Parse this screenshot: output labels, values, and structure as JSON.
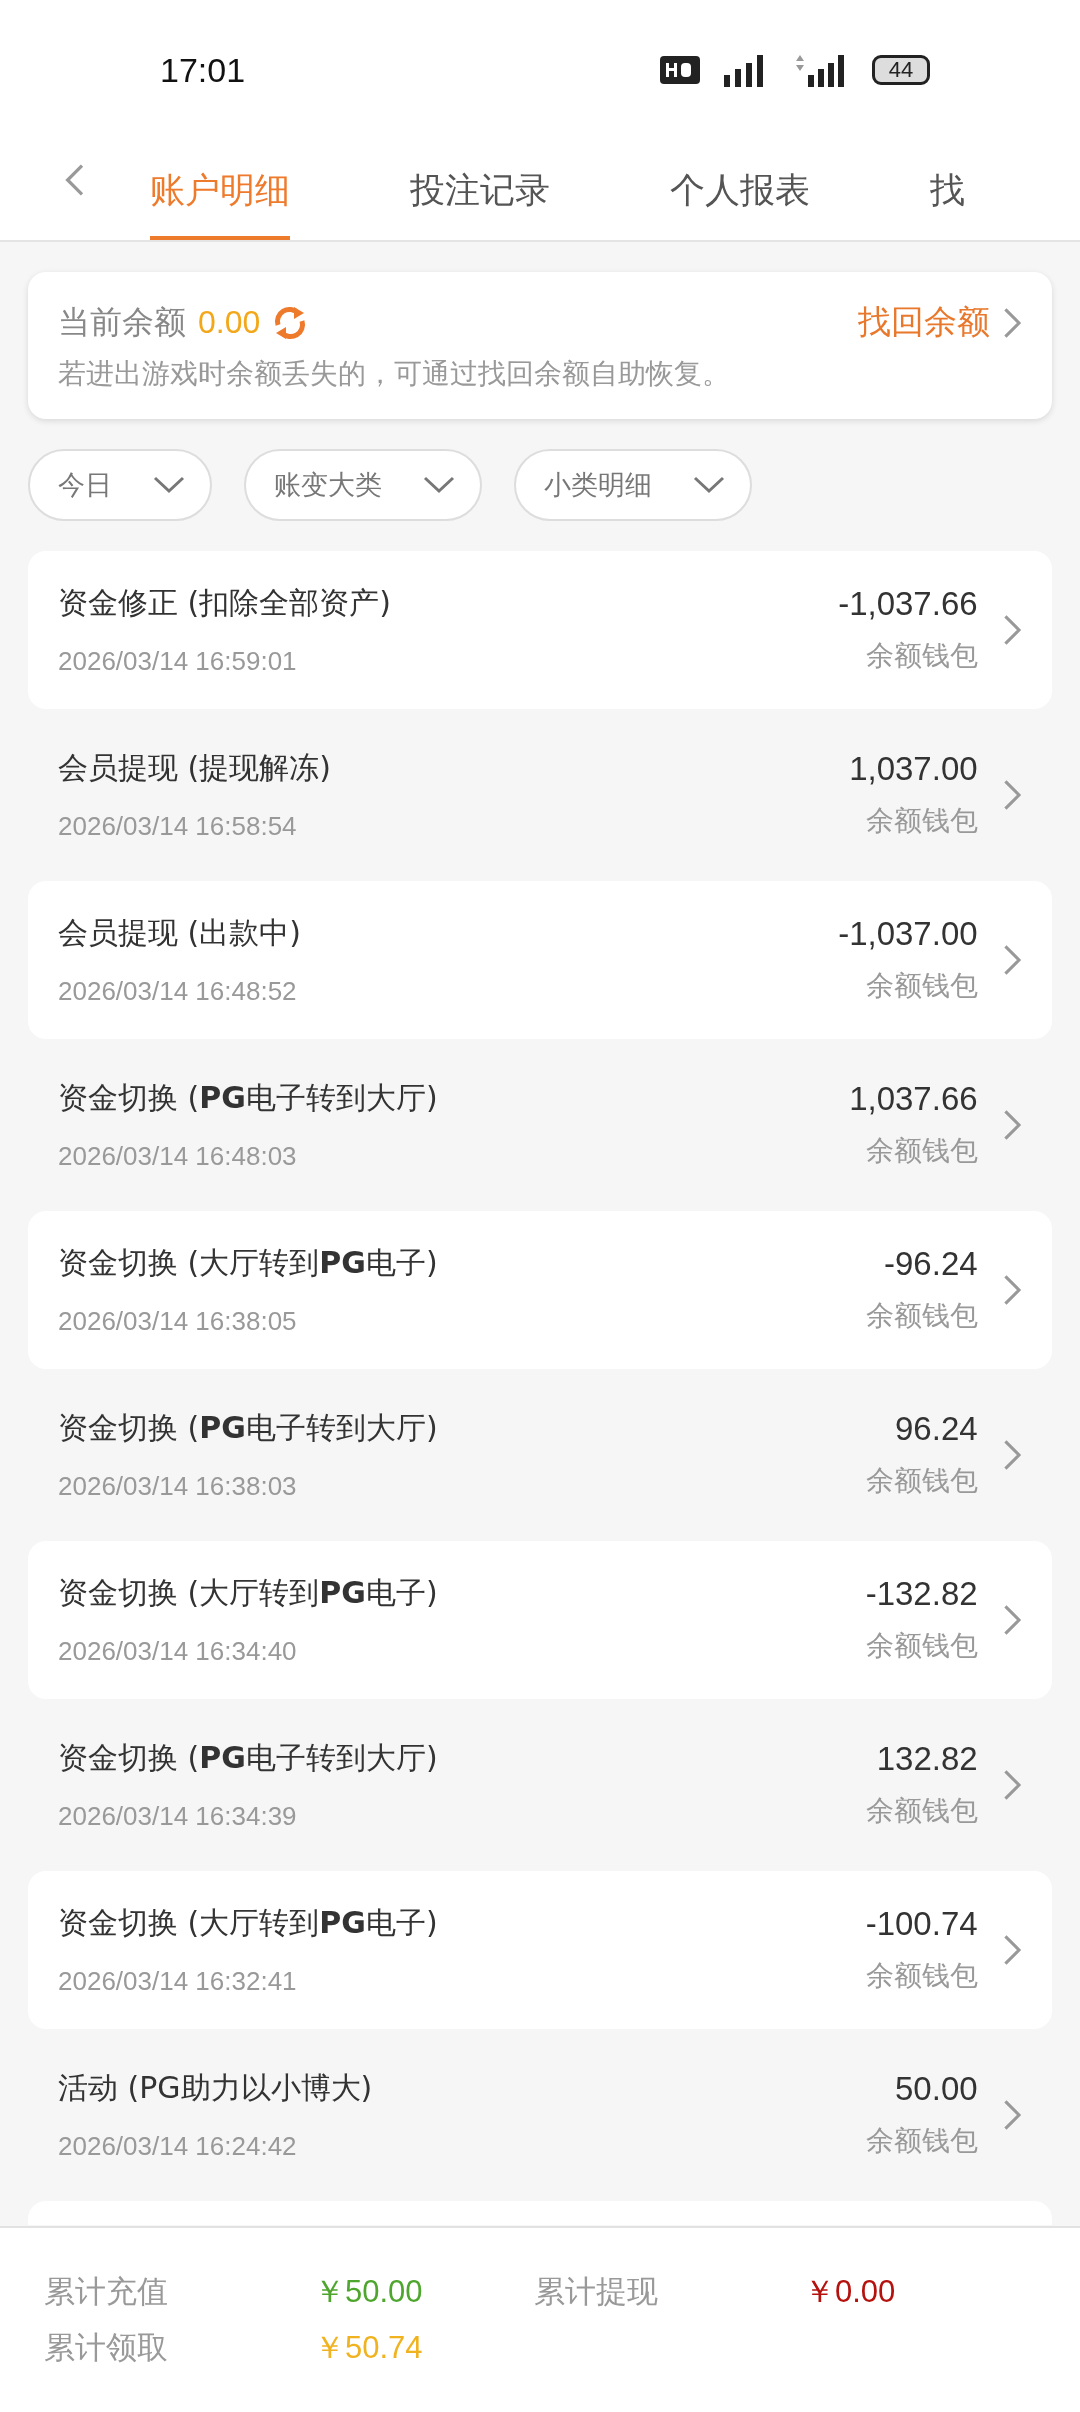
{
  "status_bar": {
    "time": "17:01",
    "battery": "44"
  },
  "tabs": [
    {
      "label": "账户明细",
      "selected": true
    },
    {
      "label": "投注记录",
      "selected": false
    },
    {
      "label": "个人报表",
      "selected": false
    },
    {
      "label": "找",
      "selected": false
    }
  ],
  "balance_card": {
    "label": "当前余额",
    "amount": "0.00",
    "link": "找回余额",
    "note": "若进出游戏时余额丢失的，可通过找回余额自助恢复。"
  },
  "filters": [
    "今日",
    "账变大类",
    "小类明细"
  ],
  "records": [
    {
      "title": "资金修正",
      "detail": "(扣除全部资产)",
      "time": "2026/03/14 16:59:01",
      "amount": "-1,037.66",
      "wallet": "余额钱包"
    },
    {
      "title": "会员提现",
      "detail": "(提现解冻)",
      "time": "2026/03/14 16:58:54",
      "amount": "1,037.00",
      "wallet": "余额钱包"
    },
    {
      "title": "会员提现",
      "detail": "(出款中)",
      "time": "2026/03/14 16:48:52",
      "amount": "-1,037.00",
      "wallet": "余额钱包"
    },
    {
      "title": "资金切换",
      "detail": "(**PG**电子转到大厅)",
      "time": "2026/03/14 16:48:03",
      "amount": "1,037.66",
      "wallet": "余额钱包"
    },
    {
      "title": "资金切换",
      "detail": "(大厅转到**PG**电子)",
      "time": "2026/03/14 16:38:05",
      "amount": "-96.24",
      "wallet": "余额钱包"
    },
    {
      "title": "资金切换",
      "detail": "(**PG**电子转到大厅)",
      "time": "2026/03/14 16:38:03",
      "amount": "96.24",
      "wallet": "余额钱包"
    },
    {
      "title": "资金切换",
      "detail": "(大厅转到**PG**电子)",
      "time": "2026/03/14 16:34:40",
      "amount": "-132.82",
      "wallet": "余额钱包"
    },
    {
      "title": "资金切换",
      "detail": "(**PG**电子转到大厅)",
      "time": "2026/03/14 16:34:39",
      "amount": "132.82",
      "wallet": "余额钱包"
    },
    {
      "title": "资金切换",
      "detail": "(大厅转到**PG**电子)",
      "time": "2026/03/14 16:32:41",
      "amount": "-100.74",
      "wallet": "余额钱包"
    },
    {
      "title": "活动",
      "detail": "(PG助力以小博大)",
      "time": "2026/03/14 16:24:42",
      "amount": "50.00",
      "wallet": "余额钱包"
    }
  ],
  "totals": [
    {
      "label": "累计充值",
      "value": "￥50.00",
      "color": "#4ea62e"
    },
    {
      "label": "累计提现",
      "value": "￥0.00",
      "color": "#b5110d"
    },
    {
      "label": "累计领取",
      "value": "￥50.74",
      "color": "#f0b21e"
    }
  ]
}
